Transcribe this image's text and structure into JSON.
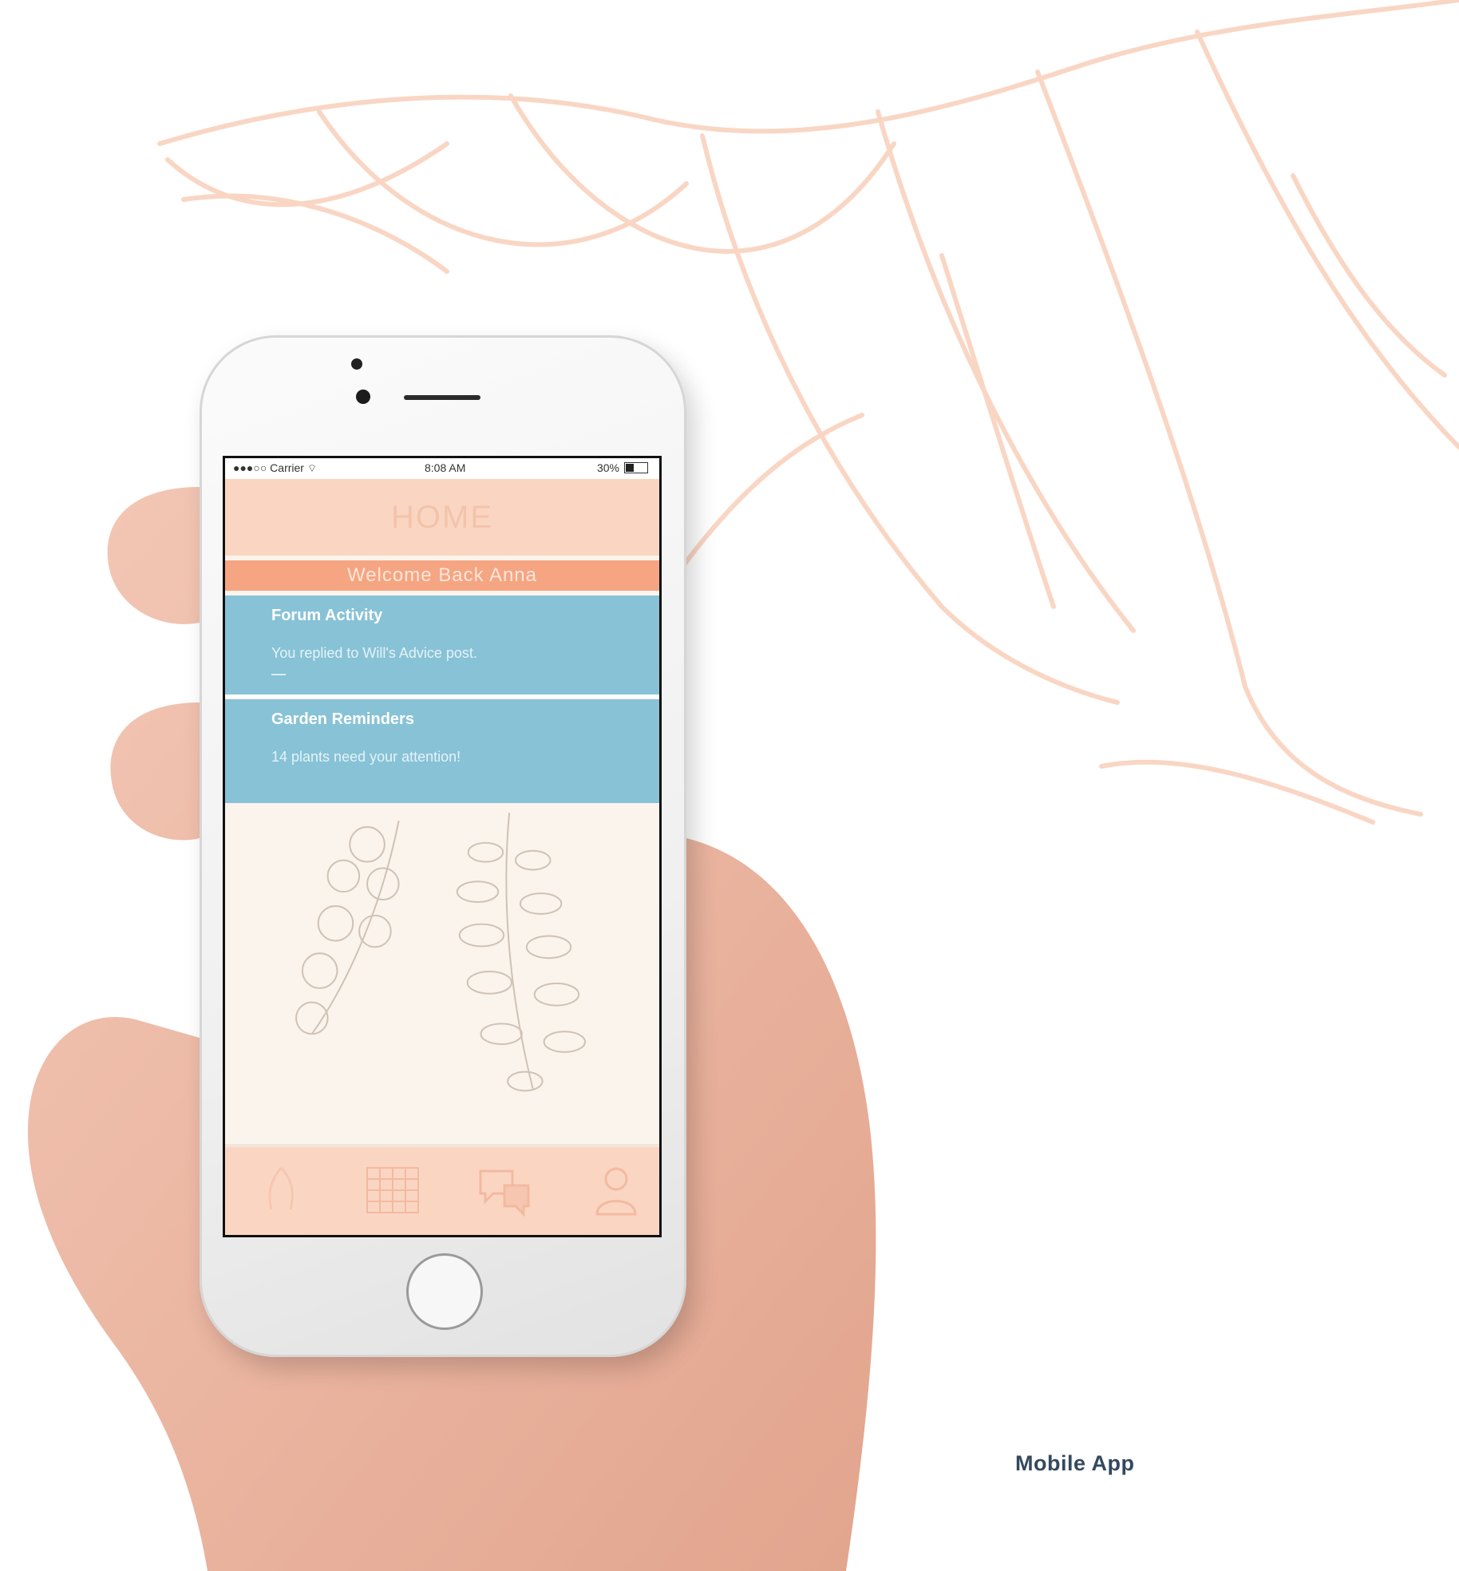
{
  "colors": {
    "accent": "#f5a582",
    "header": "#fad6c2",
    "card": "#88c2d6",
    "leaf_art": "#f9d6c4",
    "caption": "#34495e"
  },
  "status_bar": {
    "carrier": "Carrier",
    "time": "8:08 AM",
    "battery": "30%"
  },
  "app": {
    "title": "HOME",
    "welcome": "Welcome Back Anna",
    "forum": {
      "title": "Forum Activity",
      "text": "You replied to Will's Advice post."
    },
    "garden": {
      "title": "Garden Reminders",
      "text": "14 plants need your attention!"
    },
    "tabs": [
      {
        "icon": "home-icon"
      },
      {
        "icon": "calendar-icon"
      },
      {
        "icon": "chat-icon"
      },
      {
        "icon": "profile-icon"
      }
    ]
  },
  "caption": "Mobile App"
}
